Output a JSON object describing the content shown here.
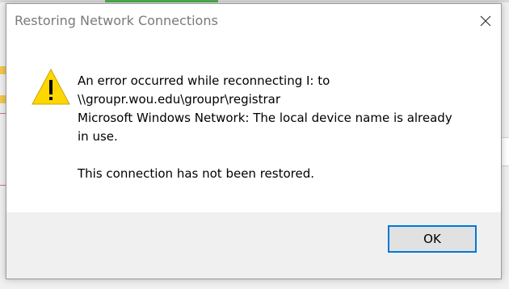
{
  "dialog": {
    "title": "Restoring Network Connections",
    "icon": "warning-icon",
    "message_lines": [
      "An error occurred while reconnecting I: to",
      "\\\\groupr.wou.edu\\groupr\\registrar",
      "Microsoft Windows Network: The local device name is already",
      "in use."
    ],
    "status_line": "This connection has not been restored.",
    "ok_label": "OK",
    "close_icon": "close-icon"
  },
  "colors": {
    "accent": "#0078d7",
    "warning_fill": "#ffd700",
    "title_text": "#7a7a7a",
    "footer_bg": "#f0f0f0"
  }
}
